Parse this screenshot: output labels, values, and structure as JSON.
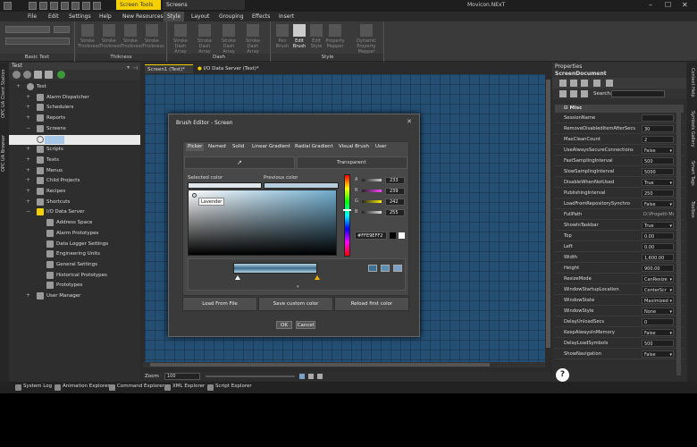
{
  "titlebar": {
    "app_title": "Movicon.NExT",
    "context_tabs": [
      "Screen Tools",
      "Screens"
    ],
    "window_controls": [
      "minimize",
      "maximize",
      "close"
    ]
  },
  "menu": {
    "items": [
      "File",
      "Edit",
      "Settings",
      "Help",
      "New Resources",
      "Style",
      "Layout",
      "Grouping",
      "Effects",
      "Insert"
    ],
    "active": "Style"
  },
  "ribbon": {
    "groups": [
      {
        "label": "Basic Text"
      },
      {
        "label": "Thikness",
        "buttons": [
          "Stroke Thickness",
          "Stroke Thickness",
          "Stroke Thickness",
          "Stroke Thickness"
        ]
      },
      {
        "label": "Dash",
        "buttons": [
          "Stroke Dash Array",
          "Stroke Dash Array",
          "Stroke Dash Array",
          "Stroke Dash Array"
        ]
      },
      {
        "label": "Style",
        "buttons": [
          "Pen Brush",
          "Edit Brush",
          "Edit Style",
          "Property Mapper",
          "Dynamic Property Mapper"
        ]
      }
    ]
  },
  "left_panel": {
    "title": "Test",
    "side_tabs": [
      "OPC UA Client Station",
      "OPC UA Browser"
    ],
    "tree": [
      {
        "label": "Test",
        "depth": 0,
        "exp": "+"
      },
      {
        "label": "Alarm Dispatcher",
        "depth": 1,
        "exp": "+"
      },
      {
        "label": "Schedulers",
        "depth": 1,
        "exp": "+"
      },
      {
        "label": "Reports",
        "depth": 1,
        "exp": "+"
      },
      {
        "label": "Screens",
        "depth": 1,
        "exp": "−"
      },
      {
        "label": "",
        "depth": 1,
        "exp": "",
        "selected": true
      },
      {
        "label": "Scripts",
        "depth": 1,
        "exp": "+"
      },
      {
        "label": "Texts",
        "depth": 1,
        "exp": "+"
      },
      {
        "label": "Menus",
        "depth": 1,
        "exp": "+"
      },
      {
        "label": "Child Projects",
        "depth": 1,
        "exp": "+"
      },
      {
        "label": "Recipes",
        "depth": 1,
        "exp": "+"
      },
      {
        "label": "Shortcuts",
        "depth": 1,
        "exp": "+"
      },
      {
        "label": "I/O Data Server",
        "depth": 1,
        "exp": "−"
      },
      {
        "label": "Address Space",
        "depth": 2,
        "exp": ""
      },
      {
        "label": "Alarm Prototypes",
        "depth": 2,
        "exp": ""
      },
      {
        "label": "Data Logger Settings",
        "depth": 2,
        "exp": ""
      },
      {
        "label": "Engineering Units",
        "depth": 2,
        "exp": ""
      },
      {
        "label": "General Settings",
        "depth": 2,
        "exp": ""
      },
      {
        "label": "Historical Prototypes",
        "depth": 2,
        "exp": ""
      },
      {
        "label": "Prototypes",
        "depth": 2,
        "exp": ""
      },
      {
        "label": "User Manager",
        "depth": 1,
        "exp": "+"
      }
    ]
  },
  "doc_tabs": [
    "Screen1 (Test)*",
    "I/O Data Server (Test)*"
  ],
  "zoom": {
    "label": "Zoom",
    "value": "100"
  },
  "bottom_tabs": [
    "System Log",
    "Animation Explorer",
    "Command Explorer",
    "XML Explorer",
    "Script Explorer"
  ],
  "properties": {
    "title": "Properties",
    "object": "ScreenDocument",
    "search_label": "Search:",
    "category": "Misc",
    "rows": [
      {
        "name": "SessionName",
        "value": ""
      },
      {
        "name": "RemoveDisabledItemAfterSecs",
        "value": "30"
      },
      {
        "name": "MaxCleanCount",
        "value": "2"
      },
      {
        "name": "UseAlwaysSecureConnections",
        "value": "False",
        "dd": true
      },
      {
        "name": "FastSamplingInterval",
        "value": "500"
      },
      {
        "name": "SlowSamplingInterval",
        "value": "5000"
      },
      {
        "name": "DisableWhenNotUsed",
        "value": "True",
        "dd": true
      },
      {
        "name": "PublishingInterval",
        "value": "250"
      },
      {
        "name": "LoadFromRepositorySynchro",
        "value": "False",
        "dd": true
      },
      {
        "name": "FullPath",
        "value": "D:\\Progetti Mo",
        "plain": true
      },
      {
        "name": "ShowInTaskbar",
        "value": "True",
        "dd": true
      },
      {
        "name": "Top",
        "value": "0.00"
      },
      {
        "name": "Left",
        "value": "0.00"
      },
      {
        "name": "Width",
        "value": "1,600.00"
      },
      {
        "name": "Height",
        "value": "900.00"
      },
      {
        "name": "ResizeMode",
        "value": "CanResize",
        "dd": true
      },
      {
        "name": "WindowStartupLocation",
        "value": "CenterScr",
        "dd": true
      },
      {
        "name": "WindowState",
        "value": "Maximized",
        "dd": true
      },
      {
        "name": "WindowStyle",
        "value": "None",
        "dd": true
      },
      {
        "name": "DelayUnloadSecs",
        "value": "0"
      },
      {
        "name": "KeepAlwaysInMemory",
        "value": "False",
        "dd": true
      },
      {
        "name": "DelayLoadSymbols",
        "value": "500"
      },
      {
        "name": "ShowNavigation",
        "value": "False",
        "dd": true
      }
    ]
  },
  "right_vtabs": [
    "Context Help",
    "Symbols Gallery",
    "Smart Tags",
    "Toolbox"
  ],
  "help_label": "?",
  "brush_editor": {
    "title": "Brush Editor - Screen",
    "tabs": [
      "Picker",
      "Named",
      "Solid",
      "Linear Gradient",
      "Radial Gradient",
      "Visual Brush",
      "User"
    ],
    "active_tab": "Picker",
    "transparent_label": "Transparent",
    "selected_color_label": "Selected color",
    "previous_color_label": "Previous color",
    "tooltip": "Lavender",
    "channels": [
      {
        "label": "A",
        "value": "233",
        "color": "#cccccc"
      },
      {
        "label": "R",
        "value": "239",
        "color": "#ff44ff"
      },
      {
        "label": "G",
        "value": "242",
        "color": "#ffee00"
      },
      {
        "label": "B",
        "value": "255",
        "color": "#dddddd"
      }
    ],
    "hex": "#FFE9EFF2",
    "buttons": [
      "Load From File",
      "Save custom color",
      "Reload first color"
    ],
    "ok_label": "OK",
    "cancel_label": "Cancel"
  },
  "colors": {
    "accent_yellow": "#f5d000",
    "canvas_blue": "#244e72"
  }
}
